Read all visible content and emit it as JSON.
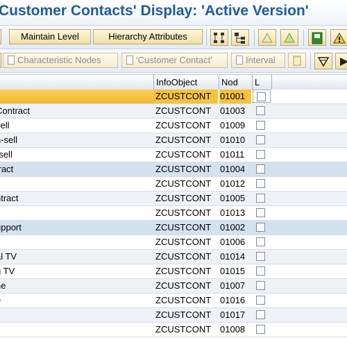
{
  "window": {
    "title": "Customer Contacts' Display: 'Active Version'"
  },
  "toolbar1": {
    "maintain_level": "Maintain Level",
    "hierarchy_attributes": "Hierarchy Attributes"
  },
  "toolbar2": {
    "characteristic_nodes": "Characteristic Nodes",
    "customer_contact": "'Customer Contact'",
    "interval": "Interval"
  },
  "table": {
    "columns": [
      "",
      "InfoObject",
      "Nod",
      "L"
    ],
    "rows": [
      {
        "desc": "",
        "infoobject": "ZCUSTCONT",
        "node": "01001"
      },
      {
        "desc": "Contract",
        "infoobject": "ZCUSTCONT",
        "node": "01003"
      },
      {
        "desc": "sell",
        "infoobject": "ZCUSTCONT",
        "node": "01009"
      },
      {
        "desc": "n-sell",
        "infoobject": "ZCUSTCONT",
        "node": "01010"
      },
      {
        "desc": "-sell",
        "infoobject": "ZCUSTCONT",
        "node": "01011"
      },
      {
        "desc": "tract",
        "infoobject": "ZCUSTCONT",
        "node": "01004"
      },
      {
        "desc": "",
        "infoobject": "ZCUSTCONT",
        "node": "01012"
      },
      {
        "desc": "ntract",
        "infoobject": "ZCUSTCONT",
        "node": "01005"
      },
      {
        "desc": "",
        "infoobject": "ZCUSTCONT",
        "node": "01013"
      },
      {
        "desc": "upport",
        "infoobject": "ZCUSTCONT",
        "node": "01002"
      },
      {
        "desc": "",
        "infoobject": "ZCUSTCONT",
        "node": "01006"
      },
      {
        "desc": "al TV",
        "infoobject": "ZCUSTCONT",
        "node": "01014"
      },
      {
        "desc": "g TV",
        "infoobject": "ZCUSTCONT",
        "node": "01015"
      },
      {
        "desc": "ne",
        "infoobject": "ZCUSTCONT",
        "node": "01007"
      },
      {
        "desc": "e",
        "infoobject": "ZCUSTCONT",
        "node": "01016"
      },
      {
        "desc": "",
        "infoobject": "ZCUSTCONT",
        "node": "01017"
      },
      {
        "desc": "",
        "infoobject": "ZCUSTCONT",
        "node": "01008"
      }
    ]
  },
  "colors": {
    "title": "#1f5b9e",
    "selected_row": "#f4c23b",
    "button_bg": "#f0dea6"
  }
}
